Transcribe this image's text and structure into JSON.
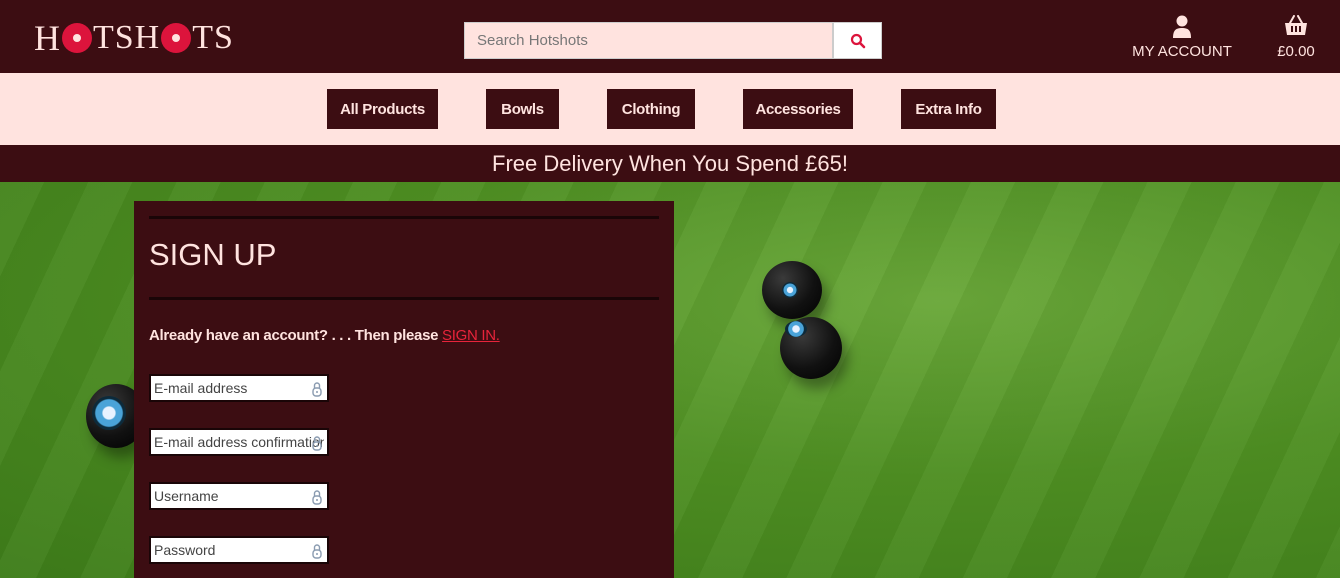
{
  "header": {
    "logo_text": "HOTSHOTS",
    "search_placeholder": "Search Hotshots",
    "account_label": "MY ACCOUNT",
    "cart_total": "£0.00"
  },
  "nav": {
    "items": [
      "All Products",
      "Bowls",
      "Clothing",
      "Accessories",
      "Extra Info"
    ]
  },
  "banner": {
    "text": "Free Delivery When You Spend £65!"
  },
  "signup": {
    "title": "SIGN UP",
    "already_text": "Already have an account? . . . Then please",
    "signin_link": "SIGN IN.",
    "fields": {
      "email": "E-mail address",
      "email_confirm": "E-mail address confirmation",
      "username": "Username",
      "password": "Password"
    }
  },
  "colors": {
    "maroon": "#3c0d12",
    "blush": "#ffe3df",
    "accent": "#dc143c"
  },
  "icons": {
    "search": "magnifier-icon",
    "account": "user-icon",
    "cart": "basket-icon",
    "field": "lock-icon"
  }
}
